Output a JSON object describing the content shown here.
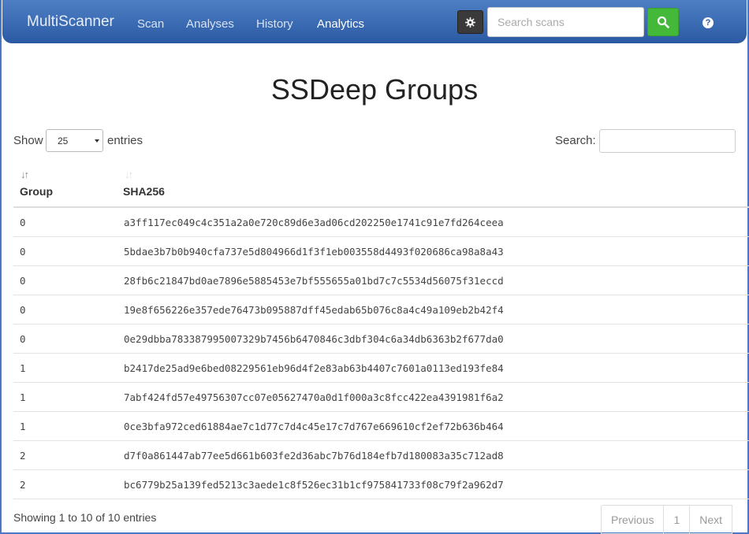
{
  "navbar": {
    "brand": "MultiScanner",
    "links": [
      "Scan",
      "Analyses",
      "History",
      "Analytics"
    ],
    "active": "Analytics",
    "search_placeholder": "Search scans",
    "help_label": "?"
  },
  "page": {
    "title": "SSDeep Groups"
  },
  "controls": {
    "show_label": "Show",
    "page_length": "25",
    "entries_label": "entries",
    "filter_label": "Search:",
    "filter_value": ""
  },
  "table": {
    "columns": [
      "Group",
      "SHA256"
    ],
    "sort": {
      "column": "Group",
      "direction": "ascending"
    },
    "rows": [
      {
        "group": "0",
        "sha256": "a3ff117ec049c4c351a2a0e720c89d6e3ad06cd202250e1741c91e7fd264ceea"
      },
      {
        "group": "0",
        "sha256": "5bdae3b7b0b940cfa737e5d804966d1f3f1eb003558d4493f020686ca98a8a43"
      },
      {
        "group": "0",
        "sha256": "28fb6c21847bd0ae7896e5885453e7bf555655a01bd7c7c5534d56075f31eccd"
      },
      {
        "group": "0",
        "sha256": "19e8f656226e357ede76473b095887dff45edab65b076c8a4c49a109eb2b42f4"
      },
      {
        "group": "0",
        "sha256": "0e29dbba783387995007329b7456b6470846c3dbf304c6a34db6363b2f677da0"
      },
      {
        "group": "1",
        "sha256": "b2417de25ad9e6bed08229561eb96d4f2e83ab63b4407c7601a0113ed193fe84"
      },
      {
        "group": "1",
        "sha256": "7abf424fd57e49756307cc07e05627470a0d1f000a3c8fcc422ea4391981f6a2"
      },
      {
        "group": "1",
        "sha256": "0ce3bfa972ced61884ae7c1d77c7d4c45e17c7d767e669610cf2ef72b636b464"
      },
      {
        "group": "2",
        "sha256": "d7f0a861447ab77ee5d661b603fe2d36abc7b76d184efb7d180083a35c712ad8"
      },
      {
        "group": "2",
        "sha256": "bc6779b25a139fed5213c3aede1c8f526ec31b1cf975841733f08c79f2a962d7"
      }
    ]
  },
  "footer": {
    "info": "Showing 1 to 10 of 10 entries",
    "pagination": {
      "previous": "Previous",
      "page": "1",
      "next": "Next"
    }
  },
  "colors": {
    "navbar": "#2b5aa3",
    "search_button": "#44b838",
    "frame": "#4a78c4"
  }
}
